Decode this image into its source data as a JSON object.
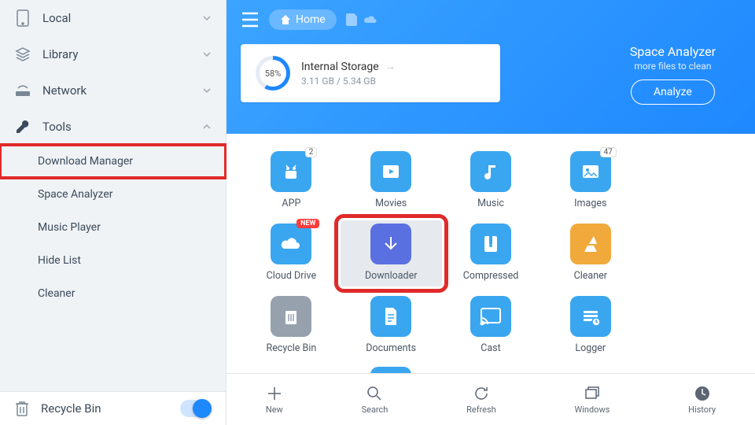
{
  "sidebar": {
    "items": [
      {
        "label": "Local"
      },
      {
        "label": "Library"
      },
      {
        "label": "Network"
      },
      {
        "label": "Tools",
        "expanded": true
      }
    ],
    "tools_sub": [
      {
        "label": "Download Manager",
        "highlight": true
      },
      {
        "label": "Space Analyzer"
      },
      {
        "label": "Music Player"
      },
      {
        "label": "Hide List"
      },
      {
        "label": "Cleaner"
      }
    ],
    "recycle": {
      "label": "Recycle Bin",
      "toggle": true
    }
  },
  "header": {
    "home_label": "Home",
    "storage": {
      "pct": "58%",
      "title": "Internal Storage",
      "detail": "3.11 GB / 5.34 GB"
    },
    "analyzer": {
      "title": "Space Analyzer",
      "sub": "more files to clean",
      "btn": "Analyze"
    }
  },
  "grid": [
    {
      "label": "APP",
      "badge": "2",
      "color": "#3aa6f0"
    },
    {
      "label": "Movies",
      "color": "#3aa6f0"
    },
    {
      "label": "Music",
      "color": "#3aa6f0"
    },
    {
      "label": "Images",
      "badge": "47",
      "color": "#3aa6f0"
    },
    {
      "label": "Cloud Drive",
      "new": true,
      "color": "#3aa6f0"
    },
    {
      "label": "Downloader",
      "color": "#5a6fe0",
      "selected": true,
      "highlight": true
    },
    {
      "label": "Compressed",
      "color": "#3aa6f0"
    },
    {
      "label": "Cleaner",
      "color": "#f0a93a"
    },
    {
      "label": "Recycle Bin",
      "color": "#96a1ad"
    },
    {
      "label": "Documents",
      "color": "#3aa6f0"
    },
    {
      "label": "Cast",
      "color": "#3aa6f0"
    },
    {
      "label": "Logger",
      "color": "#3aa6f0"
    }
  ],
  "bottom": [
    {
      "label": "New"
    },
    {
      "label": "Search"
    },
    {
      "label": "Refresh"
    },
    {
      "label": "Windows"
    },
    {
      "label": "History"
    }
  ]
}
